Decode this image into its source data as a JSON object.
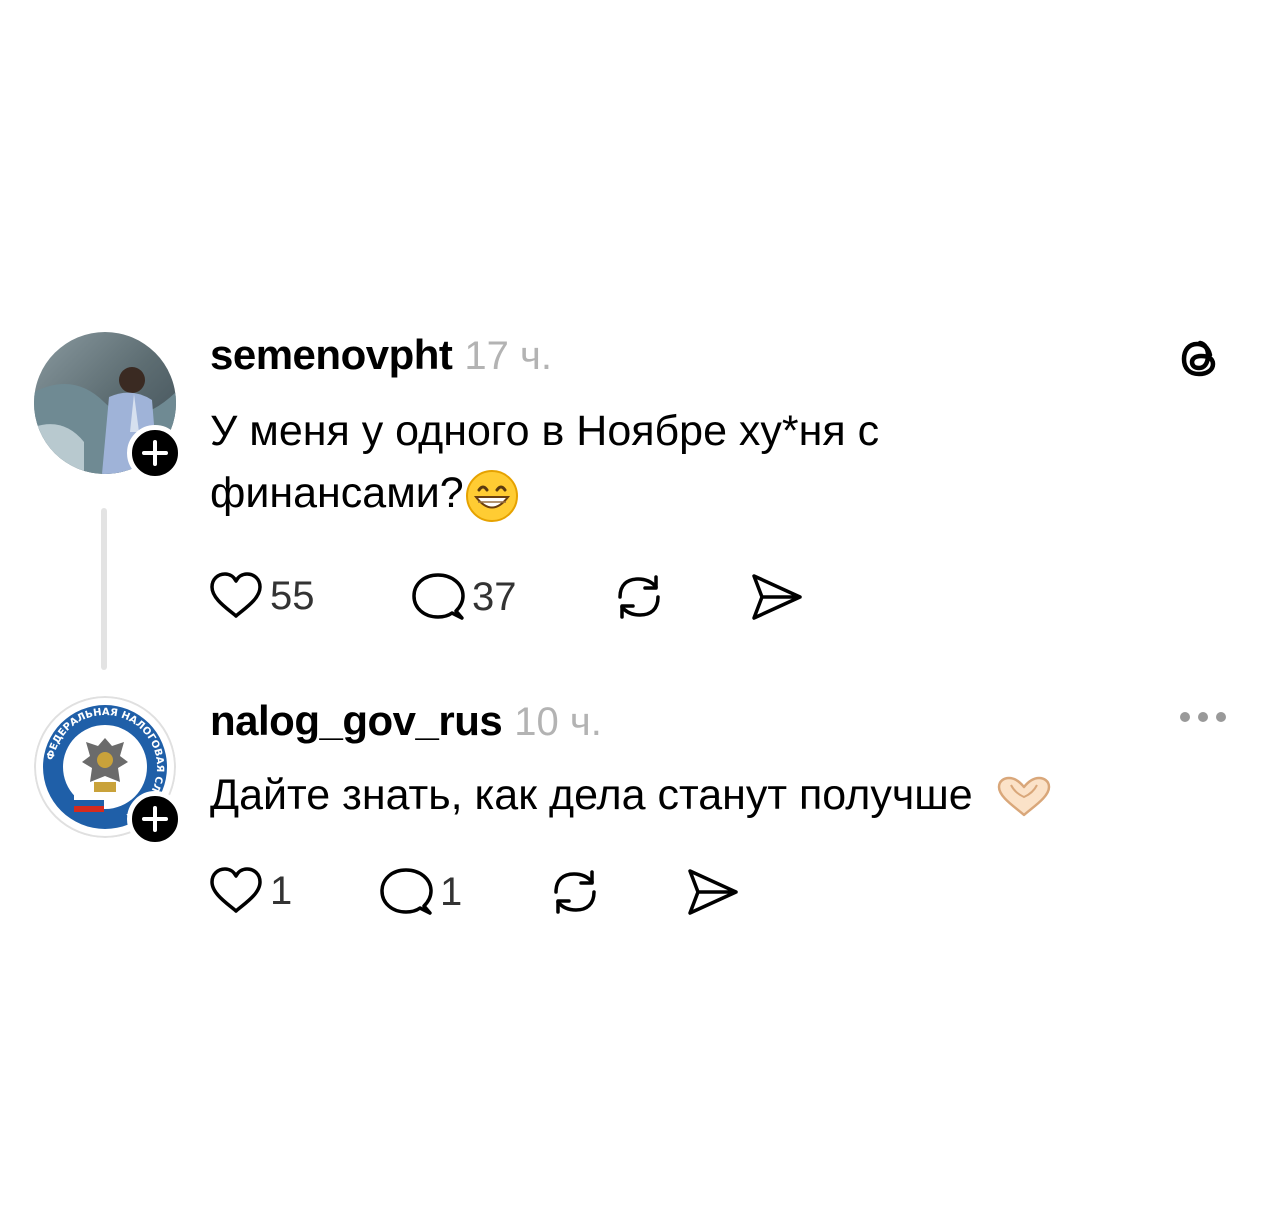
{
  "posts": [
    {
      "username": "semenovpht",
      "time": "17 ч.",
      "text_line1": "У меня у одного в Ноябре ху*ня с",
      "text_line2": "финансами?",
      "emoji": "grinning-face-with-smiling-eyes",
      "likes": "55",
      "replies": "37"
    },
    {
      "username": "nalog_gov_rus",
      "time": "10 ч.",
      "text": "Дайте знать, как дела станут получше",
      "emoji": "heart-hands",
      "likes": "1",
      "replies": "1",
      "logo_text": "ФЕДЕРАЛЬНАЯ НАЛОГОВАЯ СЛУЖБА"
    }
  ],
  "icons": {
    "app": "threads-icon",
    "more": "more-icon",
    "like": "heart-icon",
    "reply": "comment-icon",
    "repost": "repost-icon",
    "share": "send-icon",
    "follow": "plus-icon"
  },
  "colors": {
    "text": "#000000",
    "muted": "#b3b3b3",
    "thread_line": "#e3e3e3",
    "logo_blue": "#1f5fa8"
  }
}
